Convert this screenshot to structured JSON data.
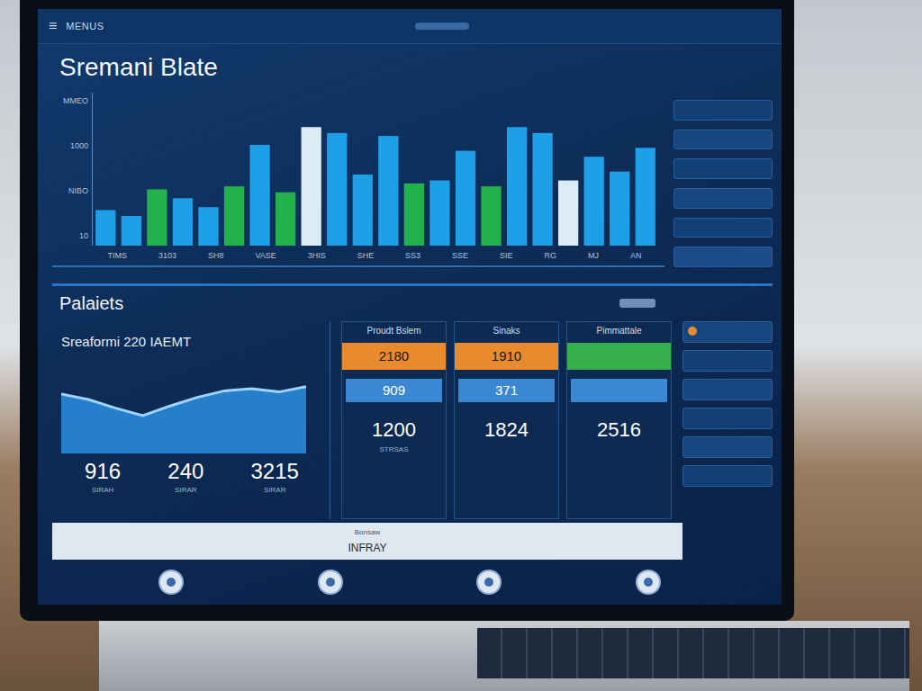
{
  "window": {
    "title": "Sremani Blate"
  },
  "menu": {
    "icon": "≡",
    "label": "MENUS"
  },
  "chart": {
    "y_ticks": [
      "MMEO",
      "1000",
      "NIBO",
      "10"
    ],
    "x_labels": [
      "TIMS",
      "3103",
      "SH8",
      "VASE",
      "3HIS",
      "SHE",
      "SS3",
      "SSE",
      "SIE",
      "RG",
      "MJ",
      "AN"
    ],
    "max": 100,
    "bars": [
      {
        "value": 24,
        "color": "#1ea0e8"
      },
      {
        "value": 20,
        "color": "#1ea0e8"
      },
      {
        "value": 38,
        "color": "#22b24c"
      },
      {
        "value": 32,
        "color": "#1ea0e8"
      },
      {
        "value": 26,
        "color": "#1ea0e8"
      },
      {
        "value": 40,
        "color": "#22b24c"
      },
      {
        "value": 68,
        "color": "#1ea0e8"
      },
      {
        "value": 36,
        "color": "#22b24c"
      },
      {
        "value": 80,
        "color": "#dcecf5"
      },
      {
        "value": 76,
        "color": "#1ea0e8"
      },
      {
        "value": 48,
        "color": "#1ea0e8"
      },
      {
        "value": 74,
        "color": "#1ea0e8"
      },
      {
        "value": 42,
        "color": "#22b24c"
      },
      {
        "value": 44,
        "color": "#1ea0e8"
      },
      {
        "value": 64,
        "color": "#1ea0e8"
      },
      {
        "value": 40,
        "color": "#22b24c"
      },
      {
        "value": 80,
        "color": "#1ea0e8"
      },
      {
        "value": 76,
        "color": "#1ea0e8"
      },
      {
        "value": 44,
        "color": "#dcecf5"
      },
      {
        "value": 60,
        "color": "#1ea0e8"
      },
      {
        "value": 50,
        "color": "#1ea0e8"
      },
      {
        "value": 66,
        "color": "#1ea0e8"
      }
    ]
  },
  "section": {
    "title": "Palaiets"
  },
  "trend": {
    "title": "Sreaformi 220 IAEMT",
    "values": [
      55,
      50,
      42,
      35,
      44,
      52,
      58,
      60,
      57,
      62
    ],
    "stats": [
      {
        "value": "916",
        "caption": "SIRAH"
      },
      {
        "value": "240",
        "caption": "SIRAR"
      },
      {
        "value": "3215",
        "caption": "SIRAR"
      }
    ]
  },
  "cards": [
    {
      "label": "Proudt Bslem",
      "header": "2180",
      "color": "#e98a2c",
      "mid": "909",
      "value": "1200",
      "caption": "STRSAS"
    },
    {
      "label": "Sinaks",
      "header": "1910",
      "color": "#e98a2c",
      "mid": "371",
      "value": "1824"
    },
    {
      "label": "Pimmattale",
      "color": "#35b04a",
      "value": "2516"
    }
  ],
  "footer": {
    "caption": "Bonsaw",
    "label": "INFRAY"
  }
}
